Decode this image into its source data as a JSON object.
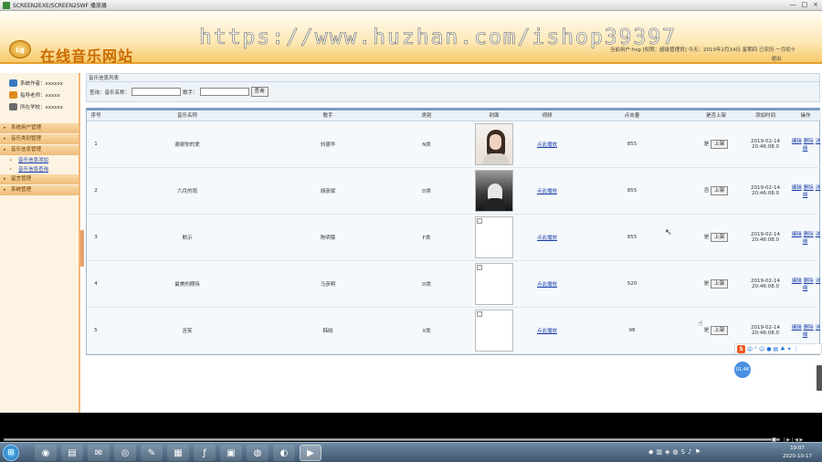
{
  "window": {
    "title": "SCREEN2EXE/SCREEN2SWF 播放器",
    "controls": [
      "—",
      "□",
      "×"
    ]
  },
  "banner": {
    "logo_text": "Lg",
    "site_title": "在线音乐网站",
    "watermark": "https://www.huzhan.com/ishop39397",
    "user_line": "当前用户:hsg [权限：超级管理员] 今天：2019年2月14日 星期四 已农历 一月初十",
    "logout": "退出"
  },
  "sidebar": {
    "info": [
      {
        "label": "系统作者：xxxxxx",
        "color": "#3b79c2"
      },
      {
        "label": "指导老师：xxxxx",
        "color": "#e08a1e"
      },
      {
        "label": "所在学校：xxxxxx",
        "color": "#6a6a6a"
      }
    ],
    "menu": [
      {
        "label": "系统用户管理",
        "subs": []
      },
      {
        "label": "音乐类别管理",
        "subs": []
      },
      {
        "label": "音乐信息管理",
        "subs": [
          "音乐信息添加",
          "音乐信息查询"
        ]
      },
      {
        "label": "留言管理",
        "subs": []
      },
      {
        "label": "系统管理",
        "subs": []
      }
    ]
  },
  "content": {
    "panel_title": "音乐信息列表",
    "search": {
      "query_label": "查询：音乐名称：",
      "name_value": "",
      "singer_label": "歌手：",
      "singer_value": "",
      "button": "查询"
    },
    "columns": [
      "序号",
      "音乐名称",
      "歌手",
      "类别",
      "封面",
      "视频",
      "点击量",
      "是否上架",
      "添加时间",
      "操作"
    ],
    "rows": [
      {
        "no": "1",
        "name": "谢谢你的爱",
        "singer": "刘德华",
        "category": "N类",
        "cover": "photo1",
        "video": "点此播放",
        "clicks": "855",
        "status": "是",
        "up_btn": "上架",
        "time": "2019-02-14 20:46:08.0",
        "ops": [
          "编辑",
          "删除",
          "详细"
        ]
      },
      {
        "no": "2",
        "name": "六月的雨",
        "singer": "胡彦斌",
        "category": "D类",
        "cover": "photo2",
        "video": "点此播放",
        "clicks": "855",
        "status": "否",
        "up_btn": "上架",
        "time": "2019-02-14 20:46:08.0",
        "ops": [
          "编辑",
          "删除",
          "详细"
        ]
      },
      {
        "no": "3",
        "name": "默示",
        "singer": "陈明菊",
        "category": "F类",
        "cover": "broken",
        "video": "点此播放",
        "clicks": "855",
        "status": "是",
        "up_btn": "上架",
        "time": "2019-02-14 20:46:08.0",
        "ops": [
          "编辑",
          "删除",
          "详细"
        ]
      },
      {
        "no": "4",
        "name": "最美的期待",
        "singer": "马彦明",
        "category": "D类",
        "cover": "broken",
        "video": "点此播放",
        "clicks": "520",
        "status": "是",
        "up_btn": "上架",
        "time": "2019-02-14 20:46:08.0",
        "ops": [
          "编辑",
          "删除",
          "详细"
        ]
      },
      {
        "no": "5",
        "name": "苦笑",
        "singer": "韩晓",
        "category": "X类",
        "cover": "broken",
        "video": "点此播放",
        "clicks": "98",
        "status": "是",
        "up_btn": "上架",
        "time": "2019-02-14 20:46:08.0",
        "ops": [
          "编辑",
          "删除",
          "详细"
        ]
      }
    ]
  },
  "overlay": {
    "ime_logo": "S",
    "ime_mode": "中",
    "timer": "01:46"
  },
  "player": {
    "time_readout": "| ▶ | ◀ ▶"
  },
  "taskbar": {
    "start": "⊞",
    "tasks": [
      "◉",
      "▤",
      "✉",
      "◎",
      "✎",
      "▦",
      "ƒ",
      "▣",
      "◍",
      "◐",
      "▶"
    ],
    "active_task_index": 10,
    "clock_time": "19:07",
    "clock_date": "2020-10-17"
  }
}
